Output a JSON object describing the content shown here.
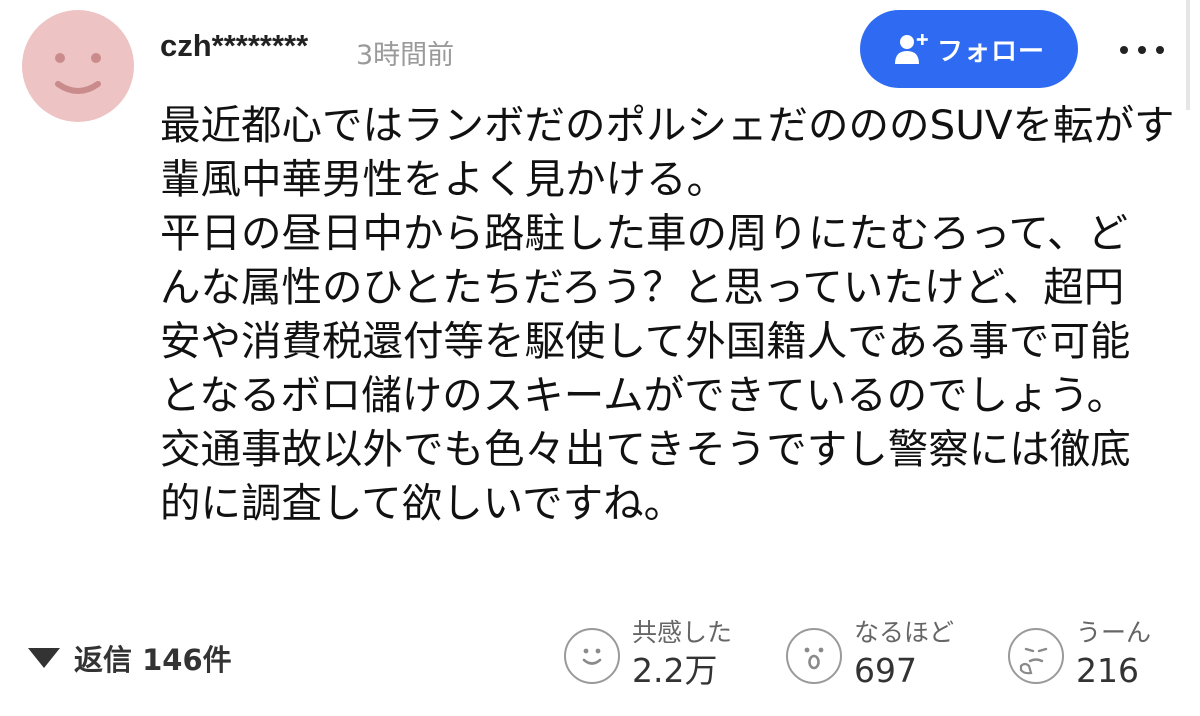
{
  "header": {
    "username": "czh********",
    "timestamp": "3時間前",
    "follow_label": "フォロー",
    "follow_icon": "person-add-icon",
    "more_icon": "more-dots-icon",
    "avatar_icon": "smiley-avatar-icon"
  },
  "comment": {
    "lines": [
      "最近都心ではランボだのポルシェだのののSUVを転がす",
      "輩風中華男性をよく見かける。",
      "平日の昼日中から路駐した車の周りにたむろって、ど",
      "んな属性のひとたちだろう？と思っていたけど、超円",
      "安や消費税還付等を駆使して外国籍人である事で可能",
      "となるボロ儲けのスキームができているのでしょう。",
      "交通事故以外でも色々出てきそうですし警察には徹底",
      "的に調査して欲しいですね。"
    ]
  },
  "footer": {
    "replies_label": "返信 146件",
    "reactions": [
      {
        "label": "共感した",
        "count": "2.2万",
        "icon": "smile-face-icon"
      },
      {
        "label": "なるほど",
        "count": "697",
        "icon": "surprised-face-icon"
      },
      {
        "label": "うーん",
        "count": "216",
        "icon": "thinking-face-icon"
      }
    ]
  },
  "colors": {
    "follow_button": "#2f6bf2",
    "avatar_bg": "#eec3c3",
    "avatar_features": "#c98b8b",
    "timestamp": "#9a9a9a"
  }
}
